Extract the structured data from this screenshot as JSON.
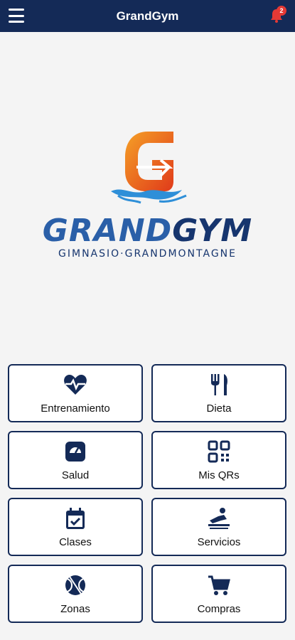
{
  "header": {
    "title": "GrandGym",
    "notification_count": "2"
  },
  "logo": {
    "word_grand": "GRAND",
    "word_gym": "GYM",
    "subtitle": "GIMNASIO·GRANDMONTAGNE"
  },
  "tiles": [
    {
      "label": "Entrenamiento",
      "icon": "heartbeat-icon"
    },
    {
      "label": "Dieta",
      "icon": "fork-knife-icon"
    },
    {
      "label": "Salud",
      "icon": "scale-icon"
    },
    {
      "label": "Mis QRs",
      "icon": "qr-code-icon"
    },
    {
      "label": "Clases",
      "icon": "calendar-check-icon"
    },
    {
      "label": "Servicios",
      "icon": "massage-icon"
    },
    {
      "label": "Zonas",
      "icon": "ball-icon"
    },
    {
      "label": "Compras",
      "icon": "cart-icon"
    }
  ],
  "colors": {
    "header": "#142a57",
    "accent_orange": "#f07a1a",
    "logo_blue": "#2a5fa8"
  }
}
